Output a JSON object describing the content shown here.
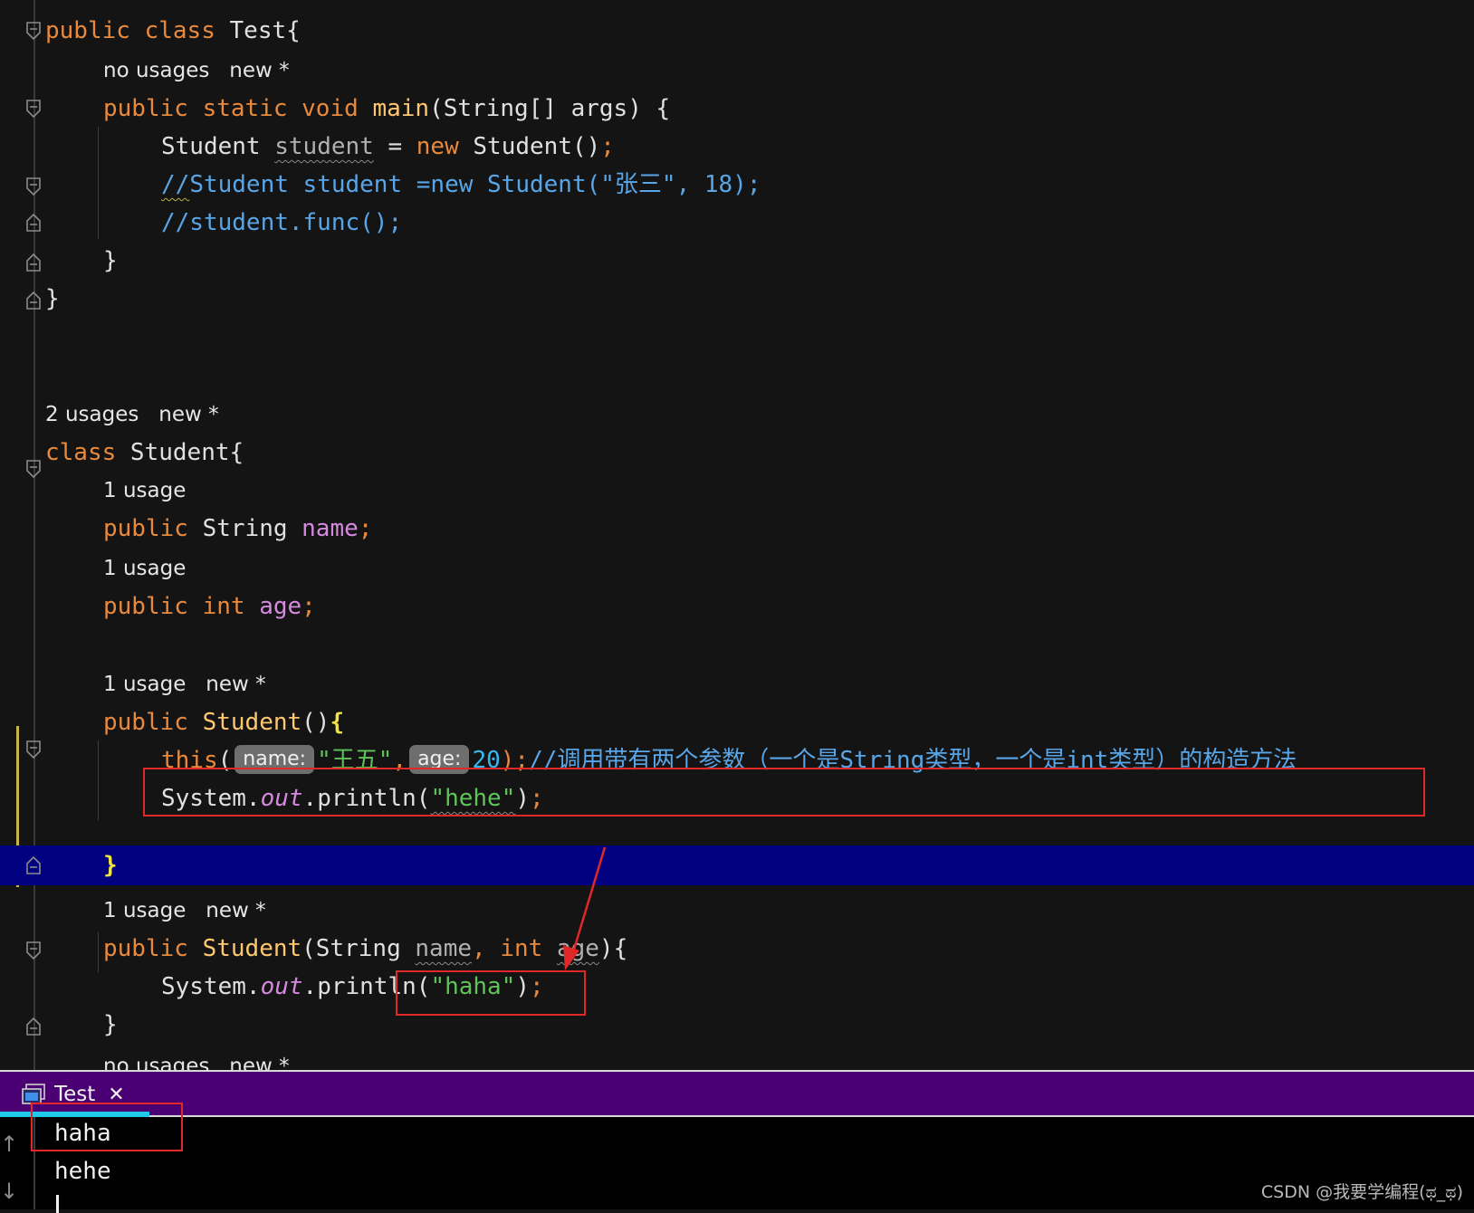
{
  "hints": {
    "test_class": "no usages   new *",
    "main": "no usages   new *",
    "student_class": "2 usages   new *",
    "name_field": "1 usage",
    "age_field": "1 usage",
    "ctor_default": "1 usage   new *",
    "ctor_params": "1 usage   new *",
    "bottom_cut": "no usages   new *"
  },
  "code": {
    "kw_public": "public",
    "kw_class": "class",
    "kw_static": "static",
    "kw_void": "void",
    "kw_new": "new",
    "kw_int": "int",
    "kw_this": "this",
    "test_name": " Test{",
    "main_fn": "main",
    "main_params": "(String[] args) {",
    "student_type": "Student ",
    "student_var": "student",
    "assign": " = ",
    "new_call": " Student()",
    "semicolon": ";",
    "comment_slashes": "//",
    "comment1_rest": "Student student =new Student(\"张三\", 18);",
    "comment2": "//student.func();",
    "close_brace": "}",
    "student_class_name": " Student{",
    "string_type": " String ",
    "field_name": "name",
    "field_age": "age",
    "ctor_name": "Student",
    "ctor_parens": "()",
    "open_brace": "{",
    "this_paren": "(",
    "param_name": "name:",
    "str_wangwu": "\"王五\"",
    "comma": ",",
    "param_age": "age:",
    "num_20": "20",
    "this_close": ");",
    "comment3": "//调用带有两个参数（一个是String类型，一个是int类型）的构造方法",
    "system": "System.",
    "out": "out",
    "println_open": ".println(",
    "str_hehe": "\"hehe\"",
    "paren_close": ")",
    "ctor2_open": "(String ",
    "p_name": "name",
    "p_age": "age",
    "ctor2_close": "){",
    "str_haha": "\"haha\""
  },
  "panel": {
    "tab_label": "Test",
    "tab_close": "✕",
    "output": [
      "haha",
      "hehe"
    ]
  },
  "watermark": "CSDN @我要学编程(ಥ_ಥ)"
}
